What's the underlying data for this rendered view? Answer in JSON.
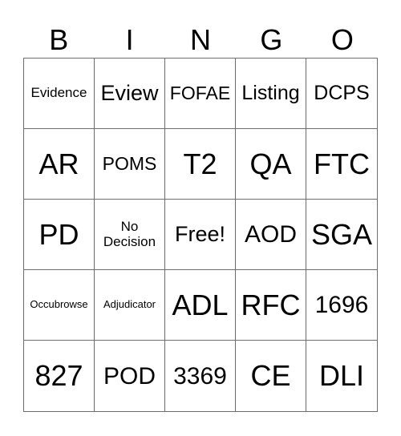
{
  "header": [
    "B",
    "I",
    "N",
    "G",
    "O"
  ],
  "cells": [
    {
      "text": "Evidence",
      "size": "s-s"
    },
    {
      "text": "Eview",
      "size": "s-m"
    },
    {
      "text": "FOFAE",
      "size": "s-sm"
    },
    {
      "text": "Listing",
      "size": "s-md"
    },
    {
      "text": "DCPS",
      "size": "s-md"
    },
    {
      "text": "AR",
      "size": "s-xl"
    },
    {
      "text": "POMS",
      "size": "s-sm"
    },
    {
      "text": "T2",
      "size": "s-xl"
    },
    {
      "text": "QA",
      "size": "s-xl"
    },
    {
      "text": "FTC",
      "size": "s-xl"
    },
    {
      "text": "PD",
      "size": "s-xl"
    },
    {
      "text": "No Decision",
      "size": "s-s"
    },
    {
      "text": "Free!",
      "size": "s-m"
    },
    {
      "text": "AOD",
      "size": "s-l"
    },
    {
      "text": "SGA",
      "size": "s-xl"
    },
    {
      "text": "Occubrowse",
      "size": "s-xs"
    },
    {
      "text": "Adjudicator",
      "size": "s-xs"
    },
    {
      "text": "ADL",
      "size": "s-xl"
    },
    {
      "text": "RFC",
      "size": "s-xl"
    },
    {
      "text": "1696",
      "size": "s-l"
    },
    {
      "text": "827",
      "size": "s-xl"
    },
    {
      "text": "POD",
      "size": "s-l"
    },
    {
      "text": "3369",
      "size": "s-l"
    },
    {
      "text": "CE",
      "size": "s-xl"
    },
    {
      "text": "DLI",
      "size": "s-xl"
    }
  ]
}
